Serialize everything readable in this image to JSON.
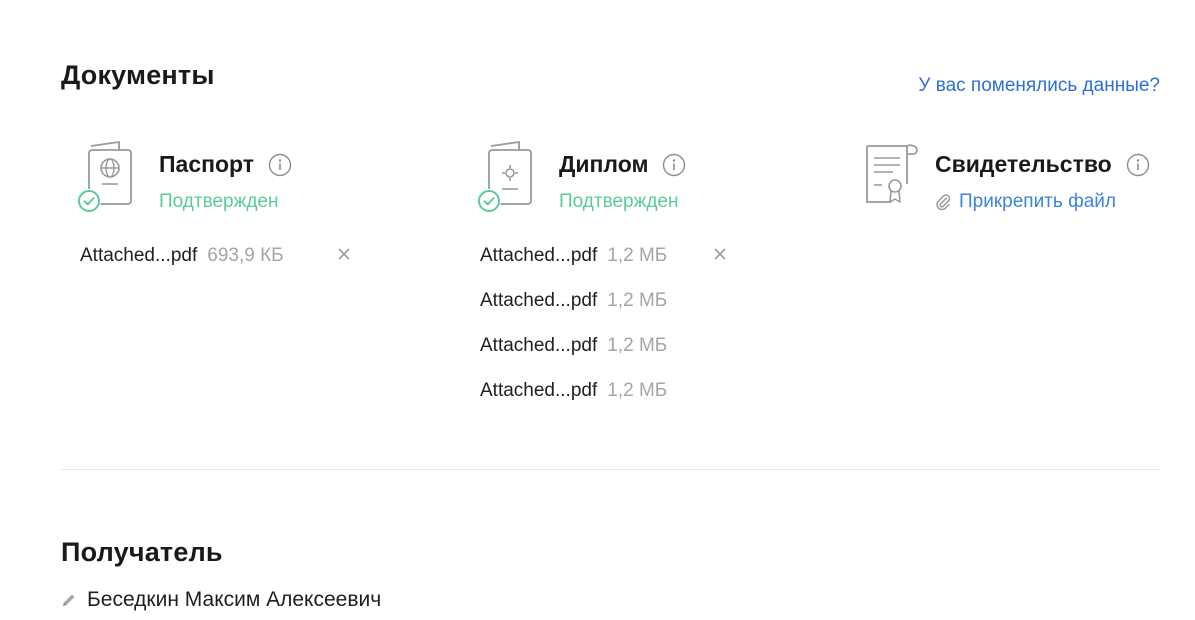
{
  "documents": {
    "title": "Документы",
    "changed_link": "У вас поменялись данные?",
    "items": [
      {
        "name": "Паспорт",
        "status": "Подтвержден",
        "icon": "passport-icon",
        "files": [
          {
            "name": "Attached...pdf",
            "size": "693,9 КБ"
          }
        ]
      },
      {
        "name": "Диплом",
        "status": "Подтвержден",
        "icon": "diploma-icon",
        "files": [
          {
            "name": "Attached...pdf",
            "size": "1,2 МБ"
          },
          {
            "name": "Attached...pdf",
            "size": "1,2 МБ"
          },
          {
            "name": "Attached...pdf",
            "size": "1,2 МБ"
          },
          {
            "name": "Attached...pdf",
            "size": "1,2 МБ"
          }
        ]
      },
      {
        "name": "Свидетельство",
        "attach_label": "Прикрепить файл",
        "icon": "certificate-icon"
      }
    ]
  },
  "recipient": {
    "title": "Получатель",
    "name": "Беседкин Максим Алексеевич"
  },
  "colors": {
    "accent_link": "#2d6fd6",
    "status_confirmed": "#5ccb96",
    "muted": "#a5a5a5"
  }
}
